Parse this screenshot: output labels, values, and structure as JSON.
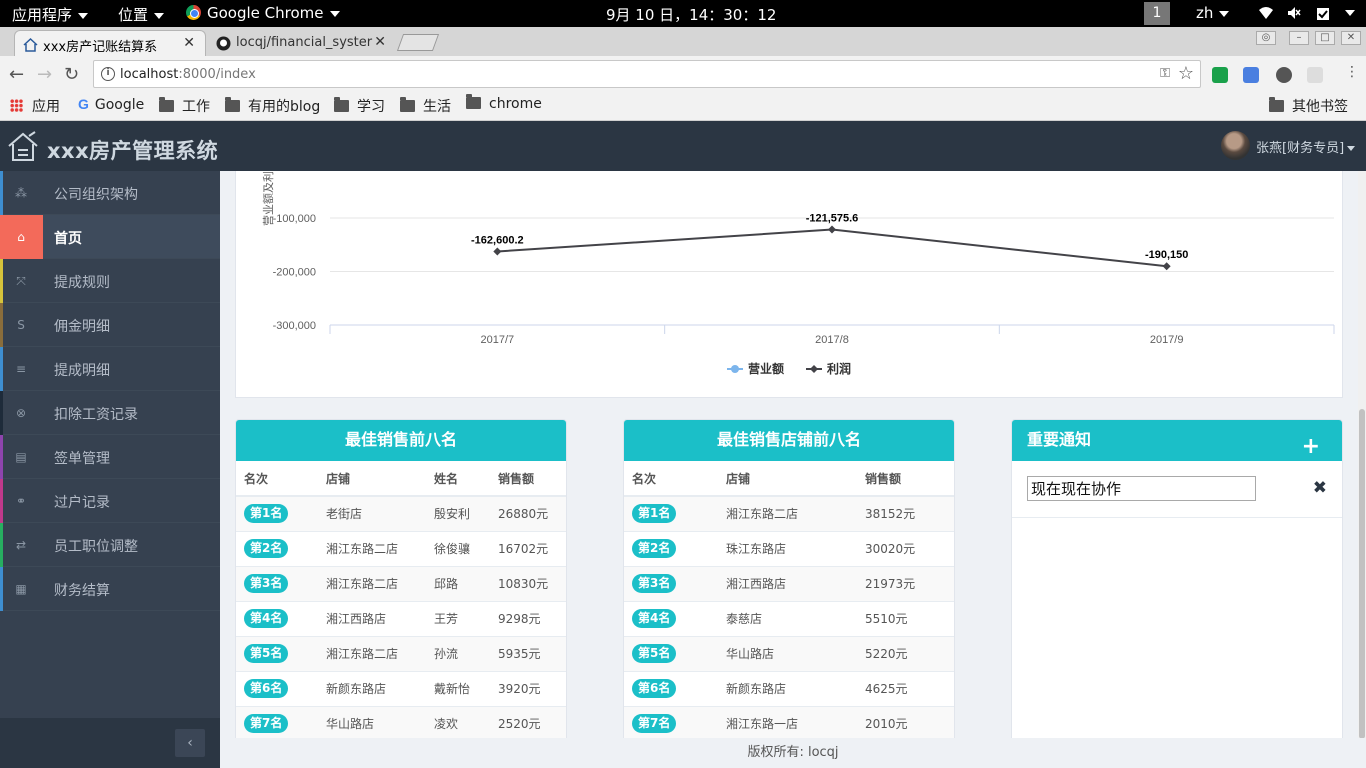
{
  "system_bar": {
    "apps": "应用程序",
    "places": "位置",
    "app_name": "Google Chrome",
    "clock": "9月 10 日，14：30：12",
    "workspace": "1",
    "lang": "zh"
  },
  "tabs": [
    {
      "title": "xxx房产记账结算系",
      "close": "✕"
    },
    {
      "title": "locqj/financial_syster",
      "close": "✕"
    }
  ],
  "toolbar": {
    "url_host": "localhost",
    "url_rest": ":8000/index"
  },
  "bookmarks": {
    "apps": "应用",
    "items": [
      "Google",
      "工作",
      "有用的blog",
      "学习",
      "生活",
      "chrome"
    ],
    "other": "其他书签"
  },
  "app": {
    "title": "xxx房产管理系统",
    "user": "张燕[财务专员]"
  },
  "sidebar": {
    "items": [
      {
        "label": "公司组织架构",
        "icon": "sitemap-icon",
        "color": "#3e8ed0"
      },
      {
        "label": "首页",
        "icon": "home-icon",
        "color": "#f36a5a"
      },
      {
        "label": "提成规则",
        "icon": "expand-icon",
        "color": "#d6c33b"
      },
      {
        "label": "佣金明细",
        "icon": "strikethrough-icon",
        "color": "#8a6d3b"
      },
      {
        "label": "提成明细",
        "icon": "list-icon",
        "color": "#3e8ed0"
      },
      {
        "label": "扣除工资记录",
        "icon": "times-circle-icon",
        "color": "#1e2b3a"
      },
      {
        "label": "签单管理",
        "icon": "form-icon",
        "color": "#8e44ad"
      },
      {
        "label": "过户记录",
        "icon": "link-icon",
        "color": "#c0398b"
      },
      {
        "label": "员工职位调整",
        "icon": "exchange-icon",
        "color": "#27ae60"
      },
      {
        "label": "财务结算",
        "icon": "table-icon",
        "color": "#3e8ed0"
      }
    ]
  },
  "chart_data": {
    "type": "line",
    "ylabel": "营业额及利润",
    "x": [
      "2017/7",
      "2017/8",
      "2017/9"
    ],
    "ytick_labels": [
      "-100,000",
      "-200,000",
      "-300,000"
    ],
    "ytick_values": [
      -100000,
      -200000,
      -300000
    ],
    "series": [
      {
        "name": "营业额",
        "color": "#7cb5ec",
        "values": []
      },
      {
        "name": "利润",
        "color": "#434348",
        "values": [
          -162600.2,
          -121575.6,
          -190150
        ],
        "labels": [
          "-162,600.2",
          "-121,575.6",
          "-190,150"
        ]
      }
    ]
  },
  "panels": {
    "sales": {
      "title": "最佳销售前八名",
      "headers": [
        "名次",
        "店铺",
        "姓名",
        "销售额"
      ],
      "rows": [
        [
          "第1名",
          "老街店",
          "殷安利",
          "26880元"
        ],
        [
          "第2名",
          "湘江东路二店",
          "徐俊骧",
          "16702元"
        ],
        [
          "第3名",
          "湘江东路二店",
          "邱路",
          "10830元"
        ],
        [
          "第4名",
          "湘江西路店",
          "王芳",
          "9298元"
        ],
        [
          "第5名",
          "湘江东路二店",
          "孙流",
          "5935元"
        ],
        [
          "第6名",
          "新颜东路店",
          "戴新怡",
          "3920元"
        ],
        [
          "第7名",
          "华山路店",
          "凌欢",
          "2520元"
        ]
      ]
    },
    "stores": {
      "title": "最佳销售店铺前八名",
      "headers": [
        "名次",
        "店铺",
        "销售额"
      ],
      "rows": [
        [
          "第1名",
          "湘江东路二店",
          "38152元"
        ],
        [
          "第2名",
          "珠江东路店",
          "30020元"
        ],
        [
          "第3名",
          "湘江西路店",
          "21973元"
        ],
        [
          "第4名",
          "泰慈店",
          "5510元"
        ],
        [
          "第5名",
          "华山路店",
          "5220元"
        ],
        [
          "第6名",
          "新颜东路店",
          "4625元"
        ],
        [
          "第7名",
          "湘江东路一店",
          "2010元"
        ]
      ]
    },
    "notice": {
      "title": "重要通知",
      "add": "+",
      "input_value": "现在现在协作",
      "delete": "✖"
    }
  },
  "footer": "版权所有: locqj"
}
